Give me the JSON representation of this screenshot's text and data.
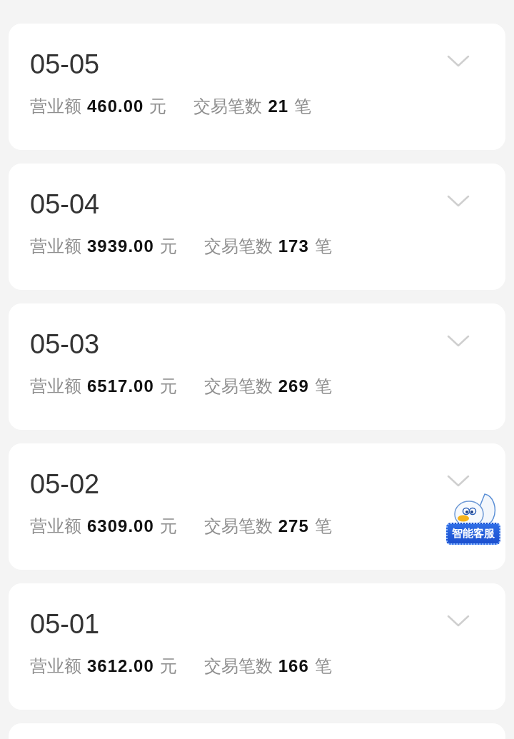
{
  "days": [
    {
      "date": "05-05",
      "revenue_label": "营业额",
      "revenue": "460.00",
      "revenue_unit": "元",
      "count_label": "交易笔数",
      "count": "21",
      "count_unit": "笔"
    },
    {
      "date": "05-04",
      "revenue_label": "营业额",
      "revenue": "3939.00",
      "revenue_unit": "元",
      "count_label": "交易笔数",
      "count": "173",
      "count_unit": "笔"
    },
    {
      "date": "05-03",
      "revenue_label": "营业额",
      "revenue": "6517.00",
      "revenue_unit": "元",
      "count_label": "交易笔数",
      "count": "269",
      "count_unit": "笔"
    },
    {
      "date": "05-02",
      "revenue_label": "营业额",
      "revenue": "6309.00",
      "revenue_unit": "元",
      "count_label": "交易笔数",
      "count": "275",
      "count_unit": "笔"
    },
    {
      "date": "05-01",
      "revenue_label": "营业额",
      "revenue": "3612.00",
      "revenue_unit": "元",
      "count_label": "交易笔数",
      "count": "166",
      "count_unit": "笔"
    }
  ],
  "assistant": {
    "label": "智能客服"
  }
}
